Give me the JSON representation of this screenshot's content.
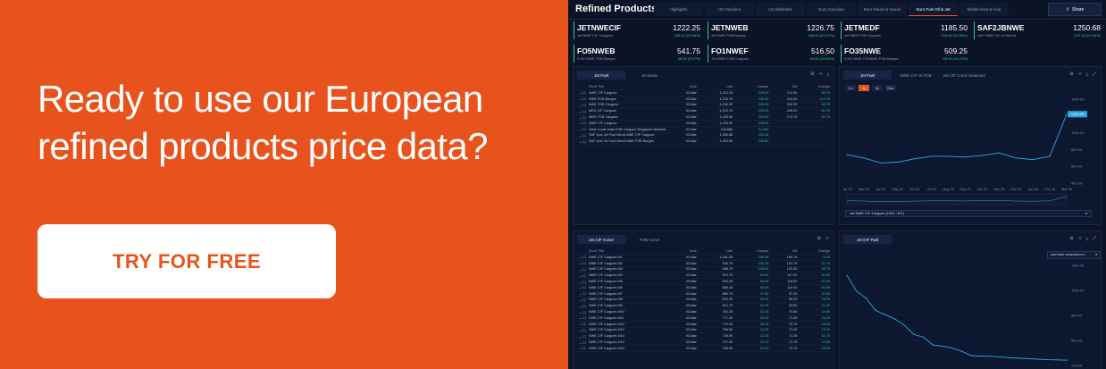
{
  "promo": {
    "headline": "Ready to use our European refined products price data?",
    "cta_label": "TRY FOR FREE"
  },
  "app": {
    "title": "Refined Products",
    "share_label": "Share",
    "tabs": [
      {
        "label": "Highlights",
        "active": false
      },
      {
        "label": "US Gasoline",
        "active": false
      },
      {
        "label": "US Distillates",
        "active": false
      },
      {
        "label": "Euro Gasoline",
        "active": false
      },
      {
        "label": "Euro Diesel & Gasoil",
        "active": false
      },
      {
        "label": "Euro Fuel Oil & Jet",
        "active": true
      },
      {
        "label": "Middle East & Asia",
        "active": false
      }
    ],
    "quotes": [
      {
        "symbol": "JETNWECIF",
        "price": "1222.25",
        "desc": "Jet NWE CIF Cargoes",
        "change": "226.00 (22.68%)"
      },
      {
        "symbol": "JETNWEB",
        "price": "1226.75",
        "desc": "Jet NWE FOB Barges",
        "change": "238.00 (24.07%)"
      },
      {
        "symbol": "JETMEDF",
        "price": "1185.50",
        "desc": "Jet MED FOB Cargoes",
        "change": "226.00 (23.55%)"
      },
      {
        "symbol": "SAF2JBNWE",
        "price": "1250.68",
        "desc": "SAF NWE 2% Jet Blend",
        "change": "224.16 (21.84%)"
      },
      {
        "symbol": "FO5NWEB",
        "price": "541.75",
        "desc": "0.5% NWE FOB Barges",
        "change": "46.50 (9.17%)"
      },
      {
        "symbol": "FO1NWEF",
        "price": "516.50",
        "desc": "1% NWE FOB Cargoes",
        "change": "69.50 (15.55%)"
      },
      {
        "symbol": "FO35NWE",
        "price": "509.25",
        "desc": "3.5% NWE CIF/NWE FOB Barges",
        "change": "65.00 (14.12%)"
      }
    ],
    "top_grid": {
      "tabs": [
        "Jet Fuel",
        "Jet Basis"
      ],
      "columns": [
        "Short Title",
        "Date",
        "Last",
        "Change",
        "Diff",
        "Change"
      ],
      "rows": [
        [
          "NWE CIF Cargoes",
          "03-Mar",
          "1,222.25",
          "226.00",
          "211.50",
          "90.75"
        ],
        [
          "NWE FOB Barges",
          "03-Mar",
          "1,226.75",
          "238.00",
          "216.00",
          "113.75"
        ],
        [
          "NWE FOB Cargoes",
          "03-Mar",
          "1,202.00",
          "226.00",
          "192.25",
          "90.75"
        ],
        [
          "MED CIF Cargoes",
          "03-Mar",
          "1,219.75",
          "225.00",
          "209.00",
          "90.75"
        ],
        [
          "MED FOB Cargoes",
          "03-Mar",
          "1,185.50",
          "226.00",
          "174.75",
          "90.75"
        ],
        [
          "NWE CIF Cargoes",
          "03-Mar",
          "1,226.00",
          "238.00",
          "",
          ""
        ],
        [
          "West Coast India FOB Cargoes Singapore Netback",
          "03-Mar",
          "126.886",
          "14.482",
          "",
          ""
        ],
        [
          "SAF 2pct Jet Fuel Blend NWE CIF Cargoes",
          "03-Mar",
          "1,250.68",
          "224.16",
          "",
          ""
        ],
        [
          "SAF 2pct Jet Fuel Blend NWE FOB Barges",
          "03-Mar",
          "1,254.83",
          "235.82",
          "",
          ""
        ]
      ]
    },
    "chart_panel": {
      "tabs": [
        "Jet Fuel",
        "NWE CIF vs FOB",
        "Jet CIF Crack Seasonal"
      ],
      "ranges": [
        "1m",
        "1y",
        "5y",
        "Max"
      ],
      "active_range": "1y",
      "series_label": "Jet NWE CIF Cargoes (USD / MT)"
    },
    "bottom_grid": {
      "tabs": [
        "Jet CIF Curve",
        "FOB Curve"
      ],
      "columns": [
        "Short Title",
        "Date",
        "Last",
        "Change",
        "Diff",
        "Change"
      ],
      "rows": [
        [
          "NWE CIF Cargoes M1",
          "03-Mar",
          "1,061.25",
          "160.00",
          "196.75",
          "73.00"
        ],
        [
          "NWE CIF Cargoes M2",
          "03-Mar",
          "996.75",
          "130.25",
          "131.75",
          "67.75"
        ],
        [
          "NWE CIF Cargoes M3",
          "03-Mar",
          "968.75",
          "108.00",
          "120.50",
          "63.75"
        ],
        [
          "NWE CIF Cargoes M4",
          "03-Mar",
          "919.75",
          "84.00",
          "117.00",
          "51.00"
        ],
        [
          "NWE CIF Cargoes M5",
          "03-Mar",
          "903.25",
          "69.25",
          "118.00",
          "52.25"
        ],
        [
          "NWE CIF Cargoes M6",
          "03-Mar",
          "886.25",
          "60.50",
          "114.00",
          "40.50"
        ],
        [
          "NWE CIF Cargoes M7",
          "03-Mar",
          "860.75",
          "47.50",
          "97.25",
          "32.00"
        ],
        [
          "NWE CIF Cargoes M8",
          "03-Mar",
          "824.25",
          "39.25",
          "90.25",
          "23.75"
        ],
        [
          "NWE CIF Cargoes M9",
          "03-Mar",
          "812.75",
          "41.75",
          "93.50",
          "21.00"
        ],
        [
          "NWE CIF Cargoes M10",
          "03-Mar",
          "782.25",
          "31.25",
          "70.50",
          "15.50"
        ],
        [
          "NWE CIF Cargoes M11",
          "03-Mar",
          "777.25",
          "30.25",
          "71.00",
          "16.25"
        ],
        [
          "NWE CIF Cargoes M12",
          "03-Mar",
          "770.25",
          "29.25",
          "70.75",
          "15.00"
        ],
        [
          "NWE CIF Cargoes M13",
          "03-Mar",
          "756.50",
          "23.50",
          "71.25",
          "12.00"
        ],
        [
          "NWE CIF Cargoes M14",
          "03-Mar",
          "739.00",
          "22.25",
          "71.25",
          "10.75"
        ],
        [
          "NWE CIF Cargoes M15",
          "03-Mar",
          "737.00",
          "22.25",
          "72.75",
          "12.50"
        ],
        [
          "NWE CIF Cargoes M16",
          "03-Mar",
          "736.50",
          "22.00",
          "72.75",
          "13.00"
        ]
      ]
    },
    "curve_panel": {
      "tabs": [
        "Jet CIF Fwd"
      ],
      "compare_label": "Add date comparison 1"
    }
  },
  "chart_data": [
    {
      "type": "line",
      "x": [
        "Jan 25",
        "Mar 25",
        "Apr 25",
        "May 25",
        "Jun 25",
        "Jul 25",
        "Aug 25",
        "Sep 25",
        "Oct 25",
        "Nov 25",
        "Dec 25",
        "Jan 26",
        "Feb 26",
        "Mar 26"
      ],
      "y": [
        740,
        700,
        640,
        650,
        690,
        720,
        720,
        710,
        730,
        760,
        700,
        680,
        720,
        1222
      ],
      "ylim": [
        400,
        1400
      ],
      "yticks": [
        "1400.00",
        "1200.00",
        "1000.00",
        "800.00",
        "600.00",
        "400.00"
      ],
      "xticks": [
        "Jan 25",
        "Mar 25",
        "Apr 25",
        "May 25",
        "Jun 25",
        "Jul 25",
        "Aug 25",
        "Sep 25",
        "Oct 25",
        "Nov 25",
        "Dec 25",
        "Jan 26",
        "Feb 26",
        "Mar 26"
      ],
      "last_value_label": "1222.25"
    },
    {
      "type": "line",
      "x": [
        1,
        2,
        3,
        4,
        5,
        6,
        7,
        8,
        9,
        10,
        11,
        12,
        13,
        14,
        15,
        16,
        17,
        18,
        19,
        20,
        21,
        22,
        23,
        24
      ],
      "y": [
        1061,
        997,
        969,
        920,
        903,
        886,
        861,
        824,
        813,
        782,
        777,
        770,
        757,
        739,
        737,
        737,
        734,
        731,
        729,
        727,
        725,
        723,
        722,
        721
      ],
      "ylim": [
        700,
        1100
      ],
      "yticks": [
        "1100.00",
        "1000.00",
        "900.00",
        "800.00",
        "700.00"
      ]
    }
  ]
}
